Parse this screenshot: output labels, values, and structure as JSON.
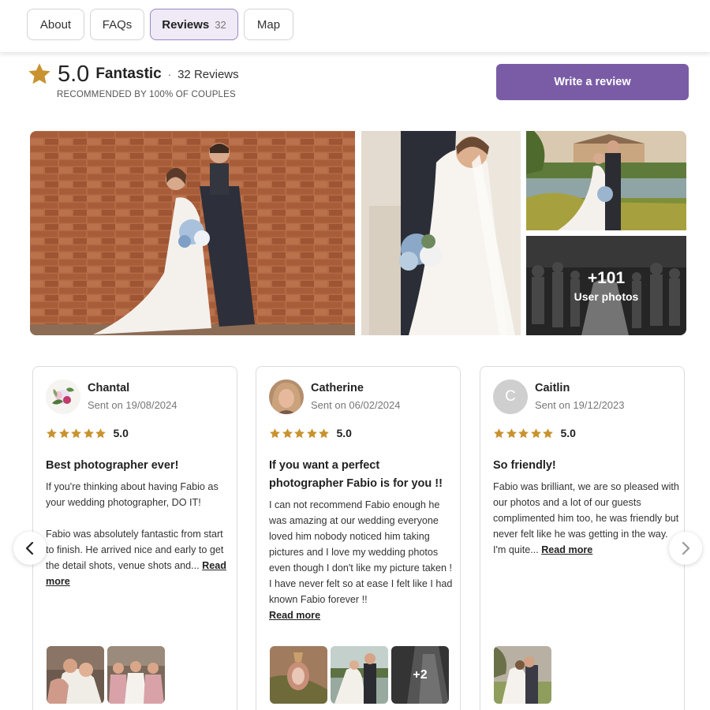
{
  "tabs": [
    {
      "label": "About"
    },
    {
      "label": "FAQs"
    },
    {
      "label": "Reviews",
      "badge": "32"
    },
    {
      "label": "Map"
    }
  ],
  "summary": {
    "rating": "5.0",
    "rating_word": "Fantastic",
    "separator": "·",
    "review_count": "32 Reviews",
    "recommended": "RECOMMENDED BY 100% OF COUPLES",
    "write_review": "Write a review"
  },
  "gallery": {
    "more_count": "+101",
    "more_label": "User photos"
  },
  "reviews": [
    {
      "name": "Chantal",
      "sent": "Sent on 19/08/2024",
      "rating": "5.0",
      "title": "Best photographer ever!",
      "body_1": "If you're thinking about having Fabio as your wedding photographer, DO IT!",
      "body_2": "Fabio was absolutely fantastic from start to finish. He arrived nice and early to get the detail shots, venue shots and...",
      "read_more": "Read more"
    },
    {
      "name": "Catherine",
      "sent": "Sent on 06/02/2024",
      "rating": "5.0",
      "title": "If you want a perfect photographer Fabio is for you !!",
      "body_1": "I can not recommend Fabio enough he was amazing at our wedding everyone loved him nobody noticed him taking pictures and I love my wedding photos even though I don't like my picture taken ! I have never felt so at ease I felt like I had known Fabio forever !!",
      "read_more": "Read more",
      "thumb_more": "+2"
    },
    {
      "name": "Caitlin",
      "avatar_letter": "C",
      "sent": "Sent on 19/12/2023",
      "rating": "5.0",
      "title": "So friendly!",
      "body_1": "Fabio was brilliant, we are so pleased with our photos and a lot of our guests complimented him too, he was friendly but never felt like he was getting in the way. I'm quite...",
      "read_more": "Read more"
    }
  ],
  "colors": {
    "accent": "#7a5ca6",
    "star": "#c8922f",
    "tab_active_bg": "#efeaf6"
  },
  "icons": {
    "star": "star-icon",
    "prev": "chevron-left-icon",
    "next": "chevron-right-icon"
  }
}
